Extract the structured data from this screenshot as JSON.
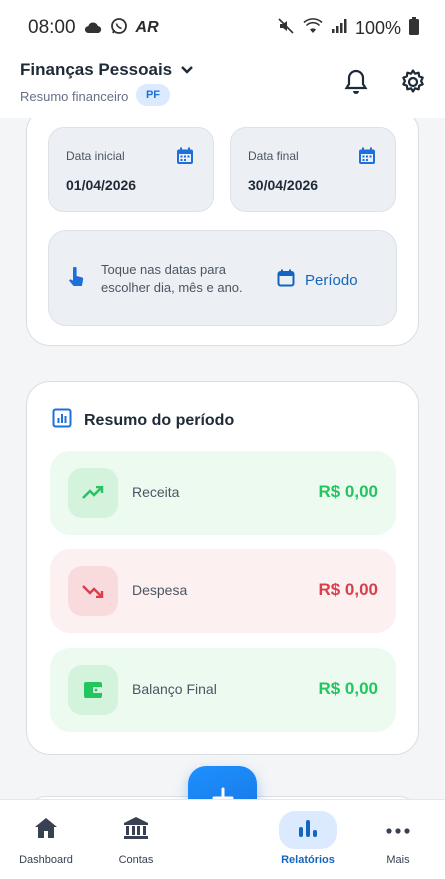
{
  "status_bar": {
    "time": "08:00",
    "battery": "100%",
    "icons": [
      "cloud-icon",
      "whatsapp-icon",
      "ar-icon",
      "mute-icon",
      "wifi-icon",
      "signal-icon",
      "battery-icon"
    ],
    "ar_text": "AR"
  },
  "app_bar": {
    "title": "Finanças Pessoais",
    "subtitle": "Resumo financeiro",
    "badge": "PF"
  },
  "dates": {
    "start_label": "Data inicial",
    "start_value": "01/04/2026",
    "end_label": "Data final",
    "end_value": "30/04/2026",
    "hint": "Toque nas datas para escolher dia, mês e ano.",
    "period_button": "Período"
  },
  "summary": {
    "title": "Resumo do período",
    "rows": [
      {
        "label": "Receita",
        "amount": "R$ 0,00"
      },
      {
        "label": "Despesa",
        "amount": "R$ 0,00"
      },
      {
        "label": "Balanço Final",
        "amount": "R$ 0,00"
      }
    ]
  },
  "bottom_nav": {
    "items": [
      {
        "label": "Dashboard"
      },
      {
        "label": "Contas"
      },
      {
        "label": "Relatórios"
      },
      {
        "label": "Mais"
      }
    ],
    "active": "Relatórios"
  },
  "colors": {
    "accent": "#1e6fd9",
    "positive": "#22c55e",
    "negative": "#d93f4b"
  }
}
